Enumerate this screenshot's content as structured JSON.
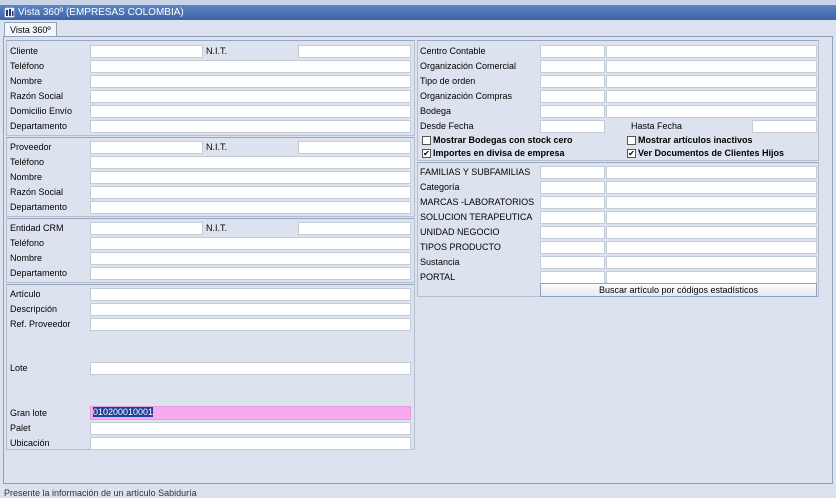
{
  "window": {
    "title": "Vista 360º (EMPRESAS COLOMBIA)"
  },
  "tabs": [
    {
      "label": "Vista 360º"
    }
  ],
  "cliente": {
    "cliente_label": "Cliente",
    "cliente_value": "",
    "nit_label": "N.I.T.",
    "nit_value": "",
    "telefono_label": "Teléfono",
    "telefono_value": "",
    "nombre_label": "Nombre",
    "nombre_value": "",
    "razon_label": "Razón Social",
    "razon_value": "",
    "domicilio_label": "Domicilio Envío",
    "domicilio_value": "",
    "departamento_label": "Departamento",
    "departamento_value": ""
  },
  "proveedor": {
    "proveedor_label": "Proveedor",
    "proveedor_value": "",
    "nit_label": "N.I.T.",
    "nit_value": "",
    "telefono_label": "Teléfono",
    "telefono_value": "",
    "nombre_label": "Nombre",
    "nombre_value": "",
    "razon_label": "Razón Social",
    "razon_value": "",
    "departamento_label": "Departamento",
    "departamento_value": ""
  },
  "crm": {
    "entidad_label": "Entidad CRM",
    "entidad_value": "",
    "nit_label": "N.I.T.",
    "nit_value": "",
    "telefono_label": "Teléfono",
    "telefono_value": "",
    "nombre_label": "Nombre",
    "nombre_value": "",
    "departamento_label": "Departamento",
    "departamento_value": ""
  },
  "articulo": {
    "articulo_label": "Artículo",
    "articulo_value": "",
    "descripcion_label": "Descripción",
    "descripcion_value": "",
    "ref_label": "Ref. Proveedor",
    "ref_value": "",
    "lote_label": "Lote",
    "lote_value": "",
    "gran_lote_label": "Gran lote",
    "gran_lote_value": "010200010001",
    "palet_label": "Palet",
    "palet_value": "",
    "ubicacion_label": "Ubicación",
    "ubicacion_value": ""
  },
  "filtros": {
    "centro_label": "Centro Contable",
    "org_comercial_label": "Organización Comercial",
    "tipo_orden_label": "Tipo de orden",
    "org_compras_label": "Organización Compras",
    "bodega_label": "Bodega",
    "desde_label": "Desde Fecha",
    "hasta_label": "Hasta Fecha",
    "chk_stock_label": "Mostrar Bodegas con stock cero",
    "chk_stock_checked": false,
    "chk_inactivos_label": "Mostrar artículos inactivos",
    "chk_inactivos_checked": false,
    "chk_divisa_label": "Importes en divisa de empresa",
    "chk_divisa_checked": true,
    "chk_hijos_label": "Ver Documentos de Clientes Hijos",
    "chk_hijos_checked": true
  },
  "estadisticos": {
    "familias_label": "FAMILIAS Y SUBFAMILIAS",
    "categoria_label": "Categoría",
    "marcas_label": "MARCAS -LABORATORIOS",
    "solucion_label": "SOLUCION TERAPEUTICA",
    "unidad_label": "UNIDAD NEGOCIO",
    "tipos_label": "TIPOS PRODUCTO",
    "sustancia_label": "Sustancia",
    "portal_label": "PORTAL",
    "buscar_button": "Buscar artículo por códigos estadísticos"
  },
  "status": {
    "text": "Presente la información de un artículo Sabiduría"
  },
  "check_mark": "✔"
}
